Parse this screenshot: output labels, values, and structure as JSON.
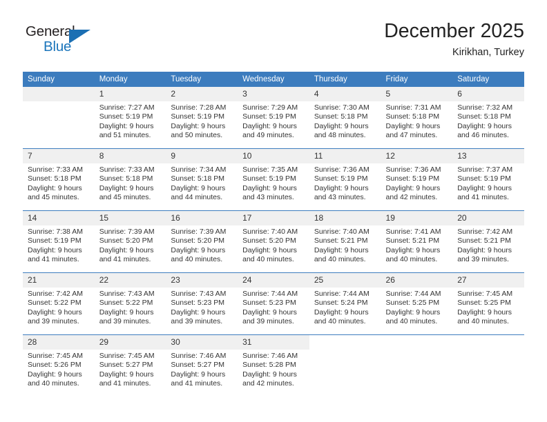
{
  "brand": {
    "name_part1": "General",
    "name_part2": "Blue",
    "triangle_color": "#1b6fb3",
    "blue_color": "#1b75bb"
  },
  "header": {
    "title": "December 2025",
    "location": "Kirikhan, Turkey"
  },
  "theme": {
    "header_row_bg": "#3c7cbe",
    "daynum_bg": "#f0f0f0",
    "text_color": "#333333"
  },
  "weekdays": [
    "Sunday",
    "Monday",
    "Tuesday",
    "Wednesday",
    "Thursday",
    "Friday",
    "Saturday"
  ],
  "weeks": [
    [
      {
        "day": "",
        "empty": true,
        "lines": []
      },
      {
        "day": "1",
        "lines": [
          "Sunrise: 7:27 AM",
          "Sunset: 5:19 PM",
          "Daylight: 9 hours",
          "and 51 minutes."
        ]
      },
      {
        "day": "2",
        "lines": [
          "Sunrise: 7:28 AM",
          "Sunset: 5:19 PM",
          "Daylight: 9 hours",
          "and 50 minutes."
        ]
      },
      {
        "day": "3",
        "lines": [
          "Sunrise: 7:29 AM",
          "Sunset: 5:19 PM",
          "Daylight: 9 hours",
          "and 49 minutes."
        ]
      },
      {
        "day": "4",
        "lines": [
          "Sunrise: 7:30 AM",
          "Sunset: 5:18 PM",
          "Daylight: 9 hours",
          "and 48 minutes."
        ]
      },
      {
        "day": "5",
        "lines": [
          "Sunrise: 7:31 AM",
          "Sunset: 5:18 PM",
          "Daylight: 9 hours",
          "and 47 minutes."
        ]
      },
      {
        "day": "6",
        "lines": [
          "Sunrise: 7:32 AM",
          "Sunset: 5:18 PM",
          "Daylight: 9 hours",
          "and 46 minutes."
        ]
      }
    ],
    [
      {
        "day": "7",
        "lines": [
          "Sunrise: 7:33 AM",
          "Sunset: 5:18 PM",
          "Daylight: 9 hours",
          "and 45 minutes."
        ]
      },
      {
        "day": "8",
        "lines": [
          "Sunrise: 7:33 AM",
          "Sunset: 5:18 PM",
          "Daylight: 9 hours",
          "and 45 minutes."
        ]
      },
      {
        "day": "9",
        "lines": [
          "Sunrise: 7:34 AM",
          "Sunset: 5:18 PM",
          "Daylight: 9 hours",
          "and 44 minutes."
        ]
      },
      {
        "day": "10",
        "lines": [
          "Sunrise: 7:35 AM",
          "Sunset: 5:19 PM",
          "Daylight: 9 hours",
          "and 43 minutes."
        ]
      },
      {
        "day": "11",
        "lines": [
          "Sunrise: 7:36 AM",
          "Sunset: 5:19 PM",
          "Daylight: 9 hours",
          "and 43 minutes."
        ]
      },
      {
        "day": "12",
        "lines": [
          "Sunrise: 7:36 AM",
          "Sunset: 5:19 PM",
          "Daylight: 9 hours",
          "and 42 minutes."
        ]
      },
      {
        "day": "13",
        "lines": [
          "Sunrise: 7:37 AM",
          "Sunset: 5:19 PM",
          "Daylight: 9 hours",
          "and 41 minutes."
        ]
      }
    ],
    [
      {
        "day": "14",
        "lines": [
          "Sunrise: 7:38 AM",
          "Sunset: 5:19 PM",
          "Daylight: 9 hours",
          "and 41 minutes."
        ]
      },
      {
        "day": "15",
        "lines": [
          "Sunrise: 7:39 AM",
          "Sunset: 5:20 PM",
          "Daylight: 9 hours",
          "and 41 minutes."
        ]
      },
      {
        "day": "16",
        "lines": [
          "Sunrise: 7:39 AM",
          "Sunset: 5:20 PM",
          "Daylight: 9 hours",
          "and 40 minutes."
        ]
      },
      {
        "day": "17",
        "lines": [
          "Sunrise: 7:40 AM",
          "Sunset: 5:20 PM",
          "Daylight: 9 hours",
          "and 40 minutes."
        ]
      },
      {
        "day": "18",
        "lines": [
          "Sunrise: 7:40 AM",
          "Sunset: 5:21 PM",
          "Daylight: 9 hours",
          "and 40 minutes."
        ]
      },
      {
        "day": "19",
        "lines": [
          "Sunrise: 7:41 AM",
          "Sunset: 5:21 PM",
          "Daylight: 9 hours",
          "and 40 minutes."
        ]
      },
      {
        "day": "20",
        "lines": [
          "Sunrise: 7:42 AM",
          "Sunset: 5:21 PM",
          "Daylight: 9 hours",
          "and 39 minutes."
        ]
      }
    ],
    [
      {
        "day": "21",
        "lines": [
          "Sunrise: 7:42 AM",
          "Sunset: 5:22 PM",
          "Daylight: 9 hours",
          "and 39 minutes."
        ]
      },
      {
        "day": "22",
        "lines": [
          "Sunrise: 7:43 AM",
          "Sunset: 5:22 PM",
          "Daylight: 9 hours",
          "and 39 minutes."
        ]
      },
      {
        "day": "23",
        "lines": [
          "Sunrise: 7:43 AM",
          "Sunset: 5:23 PM",
          "Daylight: 9 hours",
          "and 39 minutes."
        ]
      },
      {
        "day": "24",
        "lines": [
          "Sunrise: 7:44 AM",
          "Sunset: 5:23 PM",
          "Daylight: 9 hours",
          "and 39 minutes."
        ]
      },
      {
        "day": "25",
        "lines": [
          "Sunrise: 7:44 AM",
          "Sunset: 5:24 PM",
          "Daylight: 9 hours",
          "and 40 minutes."
        ]
      },
      {
        "day": "26",
        "lines": [
          "Sunrise: 7:44 AM",
          "Sunset: 5:25 PM",
          "Daylight: 9 hours",
          "and 40 minutes."
        ]
      },
      {
        "day": "27",
        "lines": [
          "Sunrise: 7:45 AM",
          "Sunset: 5:25 PM",
          "Daylight: 9 hours",
          "and 40 minutes."
        ]
      }
    ],
    [
      {
        "day": "28",
        "lines": [
          "Sunrise: 7:45 AM",
          "Sunset: 5:26 PM",
          "Daylight: 9 hours",
          "and 40 minutes."
        ]
      },
      {
        "day": "29",
        "lines": [
          "Sunrise: 7:45 AM",
          "Sunset: 5:27 PM",
          "Daylight: 9 hours",
          "and 41 minutes."
        ]
      },
      {
        "day": "30",
        "lines": [
          "Sunrise: 7:46 AM",
          "Sunset: 5:27 PM",
          "Daylight: 9 hours",
          "and 41 minutes."
        ]
      },
      {
        "day": "31",
        "lines": [
          "Sunrise: 7:46 AM",
          "Sunset: 5:28 PM",
          "Daylight: 9 hours",
          "and 42 minutes."
        ]
      },
      {
        "day": "",
        "blank": true,
        "lines": []
      },
      {
        "day": "",
        "blank": true,
        "lines": []
      },
      {
        "day": "",
        "blank": true,
        "lines": []
      }
    ]
  ]
}
